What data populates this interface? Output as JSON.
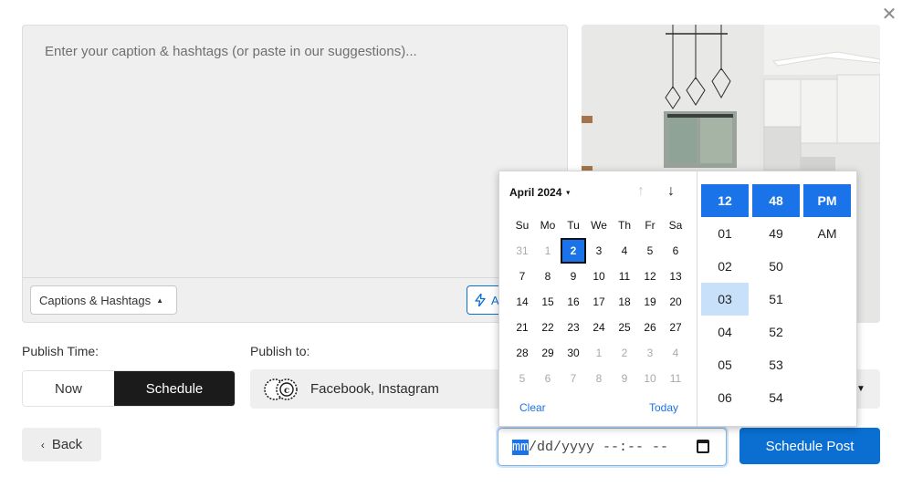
{
  "caption": {
    "placeholder": "Enter your caption & hashtags (or paste in our suggestions)...",
    "dropdown_label": "Captions & Hashtags",
    "ai_button_label": "A"
  },
  "publish_time": {
    "label": "Publish Time:",
    "options": [
      "Now",
      "Schedule"
    ],
    "selected": "Schedule"
  },
  "publish_to": {
    "label": "Publish to:",
    "value": "Facebook, Instagram"
  },
  "actions": {
    "back_label": "Back",
    "schedule_label": "Schedule Post"
  },
  "datetime_input": {
    "mm": "mm",
    "rest": "/dd/yyyy --:-- --"
  },
  "date_picker": {
    "month_label": "April 2024",
    "weekdays": [
      "Su",
      "Mo",
      "Tu",
      "We",
      "Th",
      "Fr",
      "Sa"
    ],
    "weeks": [
      [
        "31",
        "1",
        "2",
        "3",
        "4",
        "5",
        "6"
      ],
      [
        "7",
        "8",
        "9",
        "10",
        "11",
        "12",
        "13"
      ],
      [
        "14",
        "15",
        "16",
        "17",
        "18",
        "19",
        "20"
      ],
      [
        "21",
        "22",
        "23",
        "24",
        "25",
        "26",
        "27"
      ],
      [
        "28",
        "29",
        "30",
        "1",
        "2",
        "3",
        "4"
      ],
      [
        "5",
        "6",
        "7",
        "8",
        "9",
        "10",
        "11"
      ]
    ],
    "muted": [
      [
        0,
        0
      ],
      [
        0,
        1
      ],
      [
        4,
        3
      ],
      [
        4,
        4
      ],
      [
        4,
        5
      ],
      [
        4,
        6
      ],
      [
        5,
        0
      ],
      [
        5,
        1
      ],
      [
        5,
        2
      ],
      [
        5,
        3
      ],
      [
        5,
        4
      ],
      [
        5,
        5
      ],
      [
        5,
        6
      ]
    ],
    "selected_day": "2",
    "clear_label": "Clear",
    "today_label": "Today",
    "hours": [
      "12",
      "01",
      "02",
      "03",
      "04",
      "05",
      "06"
    ],
    "minutes": [
      "48",
      "49",
      "50",
      "51",
      "52",
      "53",
      "54"
    ],
    "periods": [
      "PM",
      "AM"
    ],
    "selected_hour": "12",
    "selected_minute": "48",
    "selected_period": "PM",
    "hovered_hour": "03"
  },
  "colors": {
    "accent": "#1a73e8",
    "primary_button": "#0a6fd1",
    "toggle_active": "#1b1b1b"
  },
  "icons": {
    "close": "close-icon",
    "lightning": "lightning-icon",
    "back": "chevron-left-icon",
    "calendar": "calendar-icon",
    "accounts": "account-avatar-icon"
  }
}
